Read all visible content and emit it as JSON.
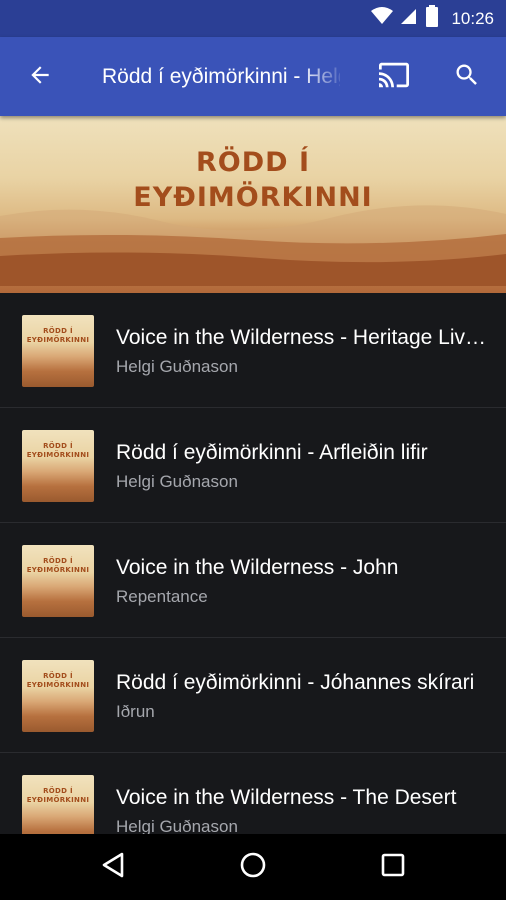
{
  "status_bar": {
    "time": "10:26",
    "icons": [
      "wifi-icon",
      "signal-icon",
      "battery-icon"
    ]
  },
  "app_bar": {
    "title": "Rödd í eyðimörkinni - Helgi Guðnason",
    "back_icon": "arrow-back-icon",
    "cast_icon": "cast-icon",
    "search_icon": "search-icon",
    "color": "#3a53b8"
  },
  "banner": {
    "line1": "RÖDD Í",
    "line2": "EYÐIMÖRKINNI"
  },
  "thumb": {
    "line1": "RÖDD Í",
    "line2": "EYÐIMÖRKINNI"
  },
  "episodes": [
    {
      "title": "Voice in the Wilderness - Heritage Lives",
      "subtitle": "Helgi Guðnason"
    },
    {
      "title": "Rödd í eyðimörkinni - Arfleiðin lifir",
      "subtitle": "Helgi Guðnason"
    },
    {
      "title": "Voice in the Wilderness - John",
      "subtitle": "Repentance"
    },
    {
      "title": "Rödd í eyðimörkinni - Jóhannes skírari",
      "subtitle": "Iðrun"
    },
    {
      "title": "Voice in the Wilderness - The Desert",
      "subtitle": "Helgi Guðnason"
    }
  ],
  "nav_bar": {
    "icons": [
      "nav-back-icon",
      "nav-home-icon",
      "nav-recents-icon"
    ]
  }
}
